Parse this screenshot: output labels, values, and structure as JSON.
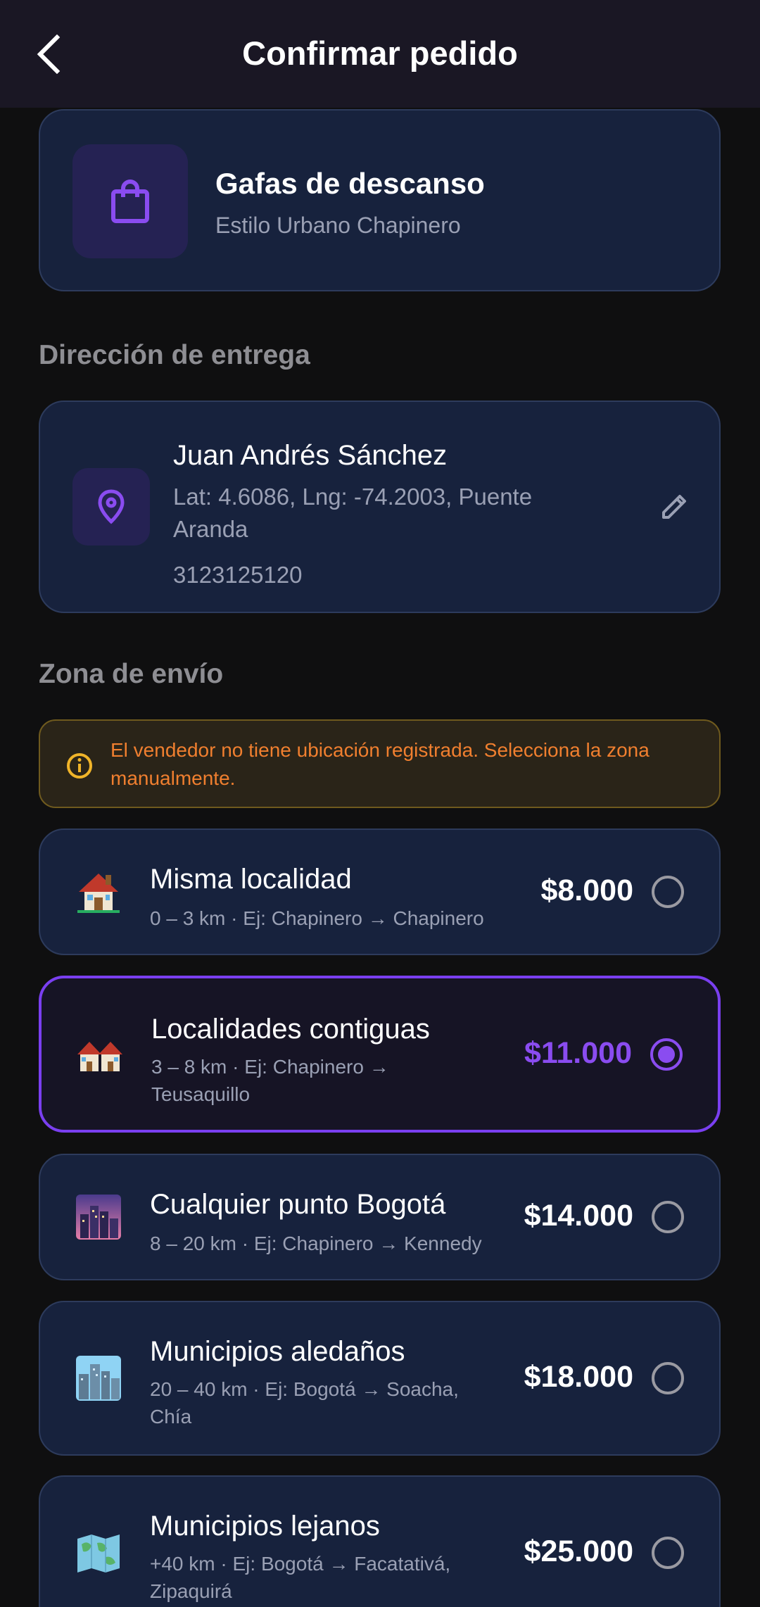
{
  "header": {
    "title": "Confirmar pedido"
  },
  "product": {
    "name": "Gafas de descanso",
    "store": "Estilo Urbano Chapinero"
  },
  "delivery": {
    "section_title": "Dirección de entrega",
    "name": "Juan Andrés Sánchez",
    "address": "Lat: 4.6086, Lng: -74.2003, Puente Aranda",
    "phone": "3123125120"
  },
  "zones": {
    "section_title": "Zona de envío",
    "warning": "El vendedor no tiene ubicación registrada. Selecciona la zona manualmente.",
    "items": [
      {
        "title": "Misma localidad",
        "desc": "0 – 3 km · Ej: Chapinero → Chapinero",
        "price": "$8.000",
        "icon": "house-icon",
        "selected": false
      },
      {
        "title": "Localidades contiguas",
        "desc": "3 – 8 km · Ej: Chapinero → Teusaquillo",
        "price": "$11.000",
        "icon": "houses-icon",
        "selected": true
      },
      {
        "title": "Cualquier punto Bogotá",
        "desc": "8 – 20 km · Ej: Chapinero → Kennedy",
        "price": "$14.000",
        "icon": "cityscape-dusk-icon",
        "selected": false
      },
      {
        "title": "Municipios aledaños",
        "desc": "20 – 40 km · Ej: Bogotá → Soacha, Chía",
        "price": "$18.000",
        "icon": "cityscape-icon",
        "selected": false
      },
      {
        "title": "Municipios lejanos",
        "desc": "+40 km · Ej: Bogotá → Facatativá, Zipaquirá",
        "price": "$25.000",
        "icon": "world-map-icon",
        "selected": false
      }
    ]
  },
  "colors": {
    "accent": "#7a3ff0",
    "card": "#17223d",
    "warning_text": "#f07f2f"
  }
}
